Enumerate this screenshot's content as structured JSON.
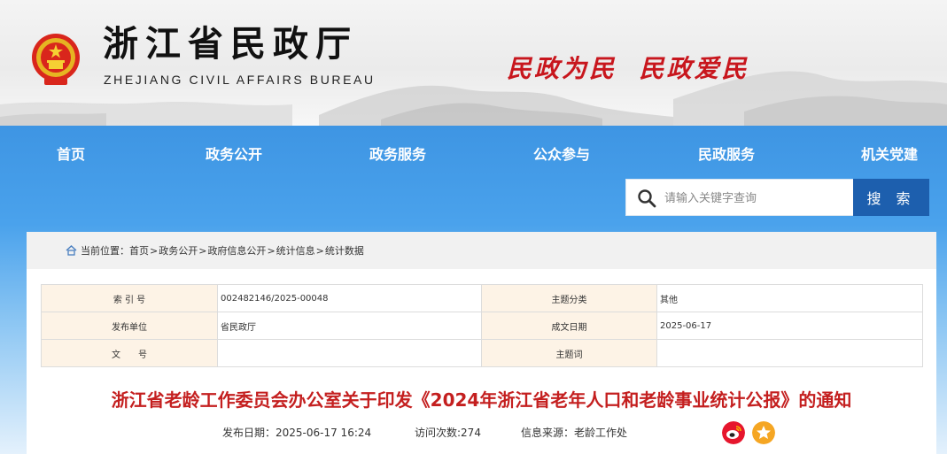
{
  "header": {
    "site_title": "浙江省民政厅",
    "site_subtitle": "ZHEJIANG CIVIL AFFAIRS BUREAU",
    "slogan": "民政为民  民政爱民",
    "emblem_icon": "national-emblem-icon"
  },
  "nav": {
    "items": [
      {
        "label": "首页"
      },
      {
        "label": "政务公开"
      },
      {
        "label": "政务服务"
      },
      {
        "label": "公众参与"
      },
      {
        "label": "民政服务"
      },
      {
        "label": "机关党建"
      }
    ]
  },
  "search": {
    "placeholder": "请输入关键字查询",
    "button_label": "搜 索",
    "icon": "search-icon"
  },
  "breadcrumb": {
    "prefix": "当前位置：",
    "items": [
      "首页",
      "政务公开",
      "政府信息公开",
      "统计信息",
      "统计数据"
    ],
    "separator": ">"
  },
  "meta_table": {
    "rows": [
      {
        "label1": "索 引 号",
        "value1": "002482146/2025-00048",
        "label2": "主题分类",
        "value2": "其他"
      },
      {
        "label1": "发布单位",
        "value1": "省民政厅",
        "label2": "成文日期",
        "value2": "2025-06-17"
      },
      {
        "label1": "文　　号",
        "value1": "",
        "label2": "主题词",
        "value2": ""
      }
    ]
  },
  "article": {
    "title": "浙江省老龄工作委员会办公室关于印发《2024年浙江省老年人口和老龄事业统计公报》的通知",
    "publish_date": "发布日期：2025-06-17 16:24",
    "visits": "访问次数:274",
    "source": "信息来源：老龄工作处"
  },
  "share": {
    "weibo_icon": "weibo-icon",
    "favorite_icon": "star-icon"
  },
  "colors": {
    "nav_blue": "#3e95e3",
    "search_button": "#1d5fae",
    "title_red": "#c41f1f",
    "slogan_red": "#c8161d",
    "label_bg": "#fdf3e6"
  }
}
